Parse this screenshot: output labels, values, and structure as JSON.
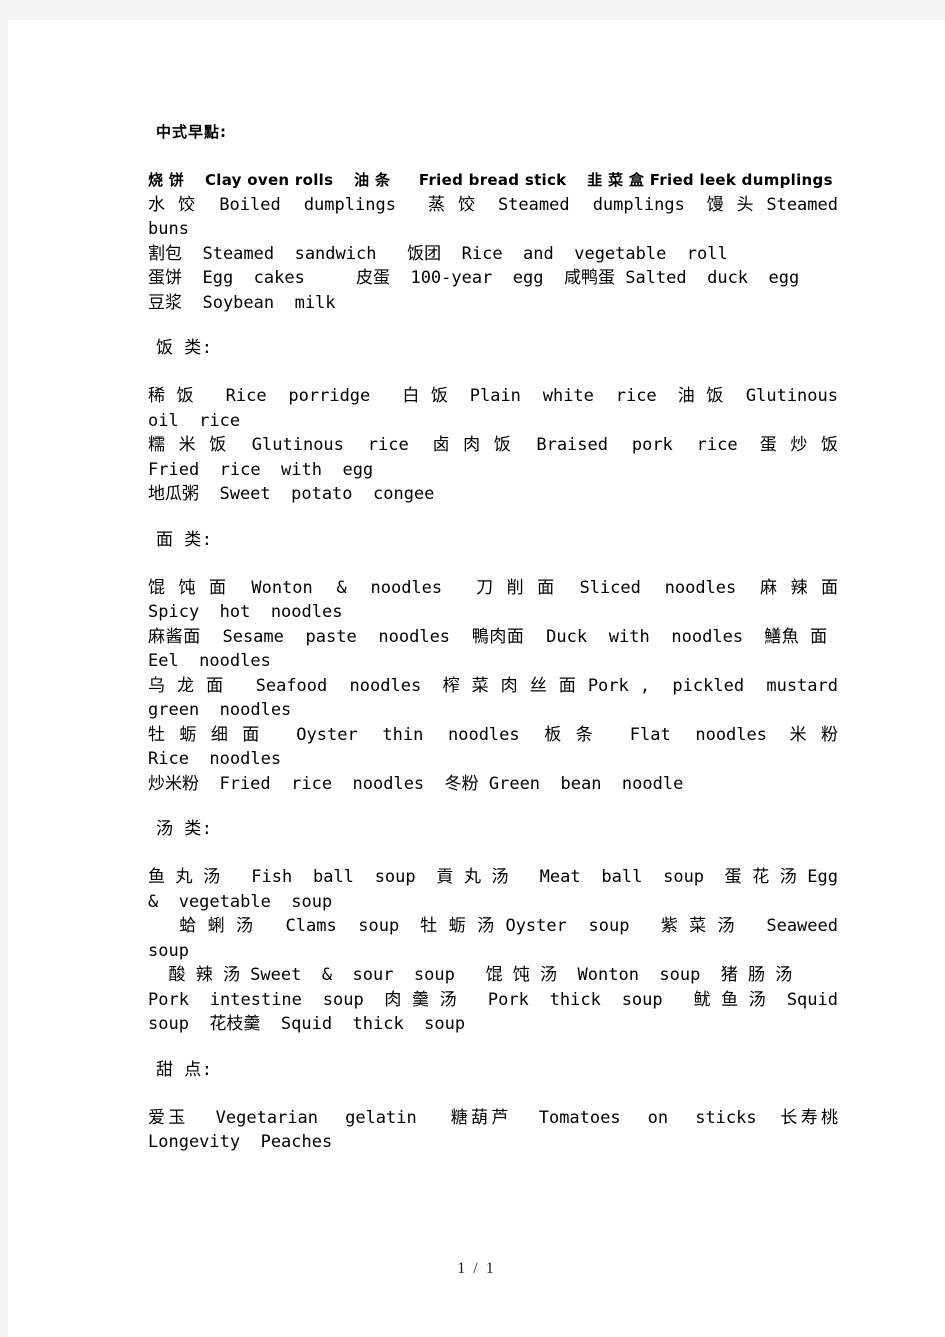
{
  "document": {
    "title": "中式早點:",
    "footer": "1 / 1",
    "sections": [
      {
        "id": "breakfast",
        "heading": "中式早點:",
        "heading_is_title": true,
        "lines": [
          {
            "style": "sans",
            "text": "烧 饼  Clay oven rolls  油 条   Fried bread stick  韭 菜 盒 Fried leek dumplings"
          },
          {
            "style": "mono",
            "text": "水 饺  Boiled  dumplings   蒸 饺  Steamed  dumplings  馒 头 Steamed  buns"
          },
          {
            "style": "mono",
            "text": "割包  Steamed  sandwich   饭团  Rice  and  vegetable  roll"
          },
          {
            "style": "mono",
            "text": "蛋饼  Egg  cakes     皮蛋  100-year  egg  咸鸭蛋 Salted  duck  egg"
          },
          {
            "style": "mono",
            "text": "豆浆  Soybean  milk"
          }
        ]
      },
      {
        "id": "rice",
        "heading": "饭 类:",
        "heading_is_title": false,
        "lines": [
          {
            "style": "mono",
            "text": "稀 饭   Rice  porridge   白 饭  Plain  white  rice  油 饭  Glutinous  oil  rice"
          },
          {
            "style": "mono",
            "text": "糯 米 饭  Glutinous  rice  卤 肉 饭  Braised  pork  rice  蛋 炒 饭 Fried  rice  with  egg"
          },
          {
            "style": "mono",
            "text": "地瓜粥  Sweet  potato  congee"
          }
        ]
      },
      {
        "id": "noodles",
        "heading": "面 类:",
        "heading_is_title": false,
        "lines": [
          {
            "style": "mono",
            "text": "馄 饨 面  Wonton  &  noodles   刀 削 面  Sliced  noodles  麻 辣 面 Spicy  hot  noodles"
          },
          {
            "style": "mono",
            "text": "麻酱面  Sesame  paste  noodles  鴨肉面  Duck  with  noodles  鱔魚 面   Eel  noodles"
          },
          {
            "style": "mono",
            "text": "乌 龙 面   Seafood  noodles  榨 菜 肉 丝 面 Pork ,  pickled  mustard  green  noodles"
          },
          {
            "style": "mono",
            "text": "牡 蛎 细 面   Oyster  thin  noodles  板 条   Flat  noodles  米 粉  Rice  noodles"
          },
          {
            "style": "mono",
            "text": "炒米粉  Fried  rice  noodles  冬粉 Green  bean  noodle"
          }
        ]
      },
      {
        "id": "soup",
        "heading": "汤 类:",
        "heading_is_title": false,
        "lines": [
          {
            "style": "mono",
            "text": "鱼 丸 汤   Fish  ball  soup  貢 丸 汤   Meat  ball  soup  蛋 花 汤 Egg  &  vegetable  soup"
          },
          {
            "style": "mono",
            "text": "   蛤 蜊 汤   Clams  soup  牡 蛎 汤 Oyster  soup   紫 菜 汤   Seaweed  soup"
          },
          {
            "style": "mono",
            "text": "  酸 辣 汤 Sweet  &  sour  soup   馄 饨 汤  Wonton  soup  猪 肠 汤"
          },
          {
            "style": "mono",
            "text": "Pork  intestine  soup  肉 羹 汤   Pork  thick  soup   鱿 鱼 汤  Squid  soup  花枝羹  Squid  thick  soup"
          }
        ]
      },
      {
        "id": "dessert",
        "heading": "甜 点:",
        "heading_is_title": false,
        "lines": [
          {
            "style": "mono",
            "text": "爱玉  Vegetarian  gelatin   糖葫芦  Tomatoes  on  sticks  长寿桃 Longevity  Peaches"
          }
        ]
      }
    ]
  }
}
